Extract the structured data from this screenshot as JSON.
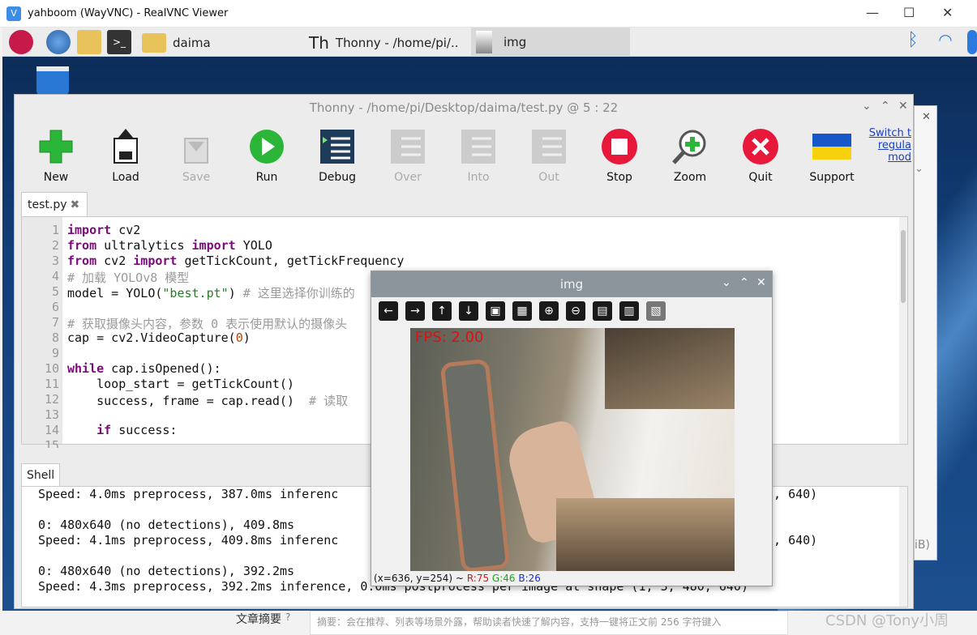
{
  "vnc": {
    "title": "yahboom (WayVNC) - RealVNC Viewer",
    "min": "—",
    "max": "☐",
    "close": "✕"
  },
  "panel": {
    "folder_label": "daima",
    "thonny_label": "Thonny  -  /home/pi/..",
    "img_label": "img"
  },
  "thonny": {
    "title": "Thonny  -  /home/pi/Desktop/daima/test.py  @  5 : 22",
    "toolbar": [
      {
        "label": "New",
        "icon": "new-icon"
      },
      {
        "label": "Load",
        "icon": "load-icon"
      },
      {
        "label": "Save",
        "icon": "save-icon"
      },
      {
        "label": "Run",
        "icon": "run-icon"
      },
      {
        "label": "Debug",
        "icon": "debug-icon"
      },
      {
        "label": "Over",
        "icon": "step-over-icon"
      },
      {
        "label": "Into",
        "icon": "step-into-icon"
      },
      {
        "label": "Out",
        "icon": "step-out-icon"
      },
      {
        "label": "Stop",
        "icon": "stop-icon"
      },
      {
        "label": "Zoom",
        "icon": "zoom-icon"
      },
      {
        "label": "Quit",
        "icon": "quit-icon"
      },
      {
        "label": "Support",
        "icon": "ukraine-flag-icon"
      }
    ],
    "switch_link": [
      "Switch t",
      "regula",
      "mod"
    ],
    "editor_tab": "test.py",
    "line_numbers": [
      "1",
      "2",
      "3",
      "4",
      "5",
      "6",
      "7",
      "8",
      "9",
      "10",
      "11",
      "12",
      "13",
      "14",
      "15"
    ],
    "shell_tab": "Shell",
    "shell_lines": [
      "Speed: 4.0ms preprocess, 387.0ms inferenc",
      "",
      "0: 480x640 (no detections), 409.8ms",
      "Speed: 4.1ms preprocess, 409.8ms inferenc",
      "",
      "0: 480x640 (no detections), 392.2ms",
      "Speed: 4.3ms preprocess, 392.2ms inference, 0.0ms postprocess per image at shape (1, 3, 480, 640)"
    ],
    "shell_tails": [
      "), 640)",
      "), 640)"
    ]
  },
  "img": {
    "title": "img",
    "fps": "FPS: 2.00",
    "coords": "(x=636, y=254) ~",
    "r": "R:75",
    "g": "G:46",
    "b": "B:26"
  },
  "side_text": "iB)",
  "bottom": {
    "label": "文章摘要",
    "summary": "摘要：会在推荐、列表等场景外露，帮助读者快速了解内容，支持一键将正文前 256 字符键入",
    "watermark": "CSDN @Tony小周"
  }
}
